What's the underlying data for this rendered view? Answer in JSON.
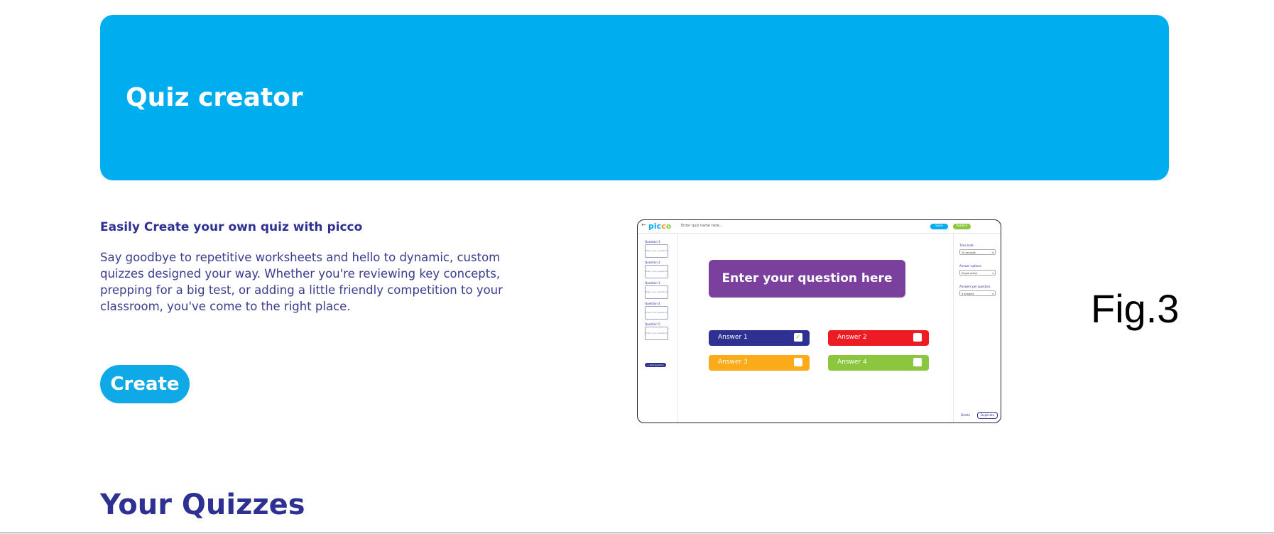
{
  "hero": {
    "title": "Quiz creator",
    "bg_color": "#00adef"
  },
  "intro": {
    "heading": "Easily Create your own quiz with picco",
    "body": "Say goodbye to repetitive worksheets and hello to dynamic, custom quizzes designed your way. Whether you're reviewing key concepts, prepping for a big test, or adding a little friendly competition to your classroom, you've come to the right place."
  },
  "create_button": {
    "label": "Create"
  },
  "section": {
    "title": "Your Quizzes"
  },
  "figure_label": "Fig.3",
  "preview": {
    "logo": {
      "p1": "pic",
      "o1": "c",
      "o2": "o"
    },
    "back_icon": "←",
    "quiz_name_placeholder": "Enter quiz name here...",
    "save_label": "Save",
    "publish_label": "Publish",
    "questions": [
      {
        "label": "Question 1",
        "thumb": "Enter your question?"
      },
      {
        "label": "Question 2",
        "thumb": "Enter your question?"
      },
      {
        "label": "Question 3",
        "thumb": "Enter your question?"
      },
      {
        "label": "Question 4",
        "thumb": "Enter your question?"
      },
      {
        "label": "Question 5",
        "thumb": "Enter your question?"
      }
    ],
    "add_question_label": "+ Add question",
    "question_placeholder": "Enter your question here",
    "answers": [
      {
        "label": "Answer 1",
        "checked": true,
        "color": "#2e3192"
      },
      {
        "label": "Answer 2",
        "checked": false,
        "color": "#ed1c24"
      },
      {
        "label": "Answer 3",
        "checked": false,
        "color": "#fbaa19"
      },
      {
        "label": "Answer 4",
        "checked": false,
        "color": "#8cc63f"
      }
    ],
    "settings": [
      {
        "label": "Time limit",
        "value": "20 seconds"
      },
      {
        "label": "Answer options",
        "value": "Single select"
      },
      {
        "label": "Answers per question",
        "value": "4 answers"
      }
    ],
    "delete_label": "Delete",
    "duplicate_label": "Duplicate"
  }
}
